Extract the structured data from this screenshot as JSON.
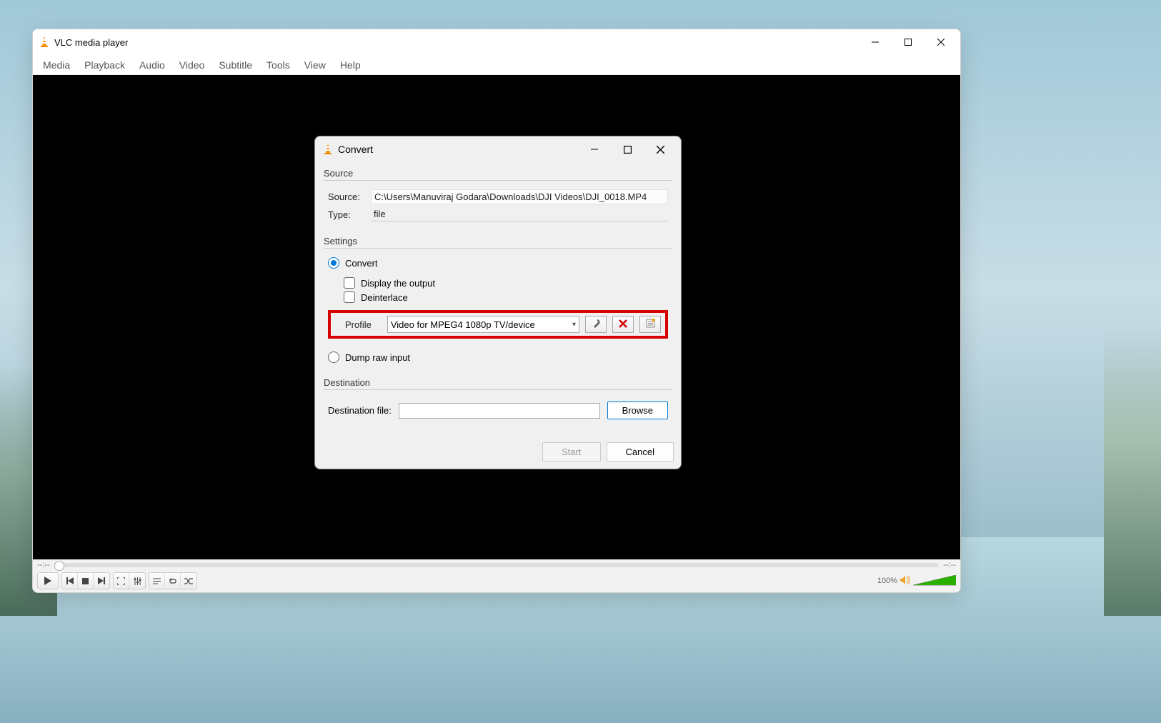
{
  "main": {
    "title": "VLC media player",
    "menus": [
      "Media",
      "Playback",
      "Audio",
      "Video",
      "Subtitle",
      "Tools",
      "View",
      "Help"
    ],
    "time_left": "--:--",
    "time_right": "--:--",
    "volume_percent": "100%"
  },
  "dialog": {
    "title": "Convert",
    "source": {
      "group": "Source",
      "source_label": "Source:",
      "source_value": "C:\\Users\\Manuviraj Godara\\Downloads\\DJI Videos\\DJI_0018.MP4",
      "type_label": "Type:",
      "type_value": "file"
    },
    "settings": {
      "group": "Settings",
      "convert": "Convert",
      "display_output": "Display the output",
      "deinterlace": "Deinterlace",
      "profile_label": "Profile",
      "profile_value": "Video for MPEG4 1080p TV/device",
      "dump_raw": "Dump raw input"
    },
    "destination": {
      "group": "Destination",
      "label": "Destination file:",
      "browse": "Browse"
    },
    "buttons": {
      "start": "Start",
      "cancel": "Cancel"
    }
  },
  "icons": {
    "minimize": "—",
    "maximize": "▢",
    "close": "✕",
    "wrench": "🔧",
    "delete": "✖",
    "new": "☰",
    "play": "▶",
    "prev": "⏮",
    "stop": "⏹",
    "next": "⏭",
    "speaker": "🔊"
  }
}
